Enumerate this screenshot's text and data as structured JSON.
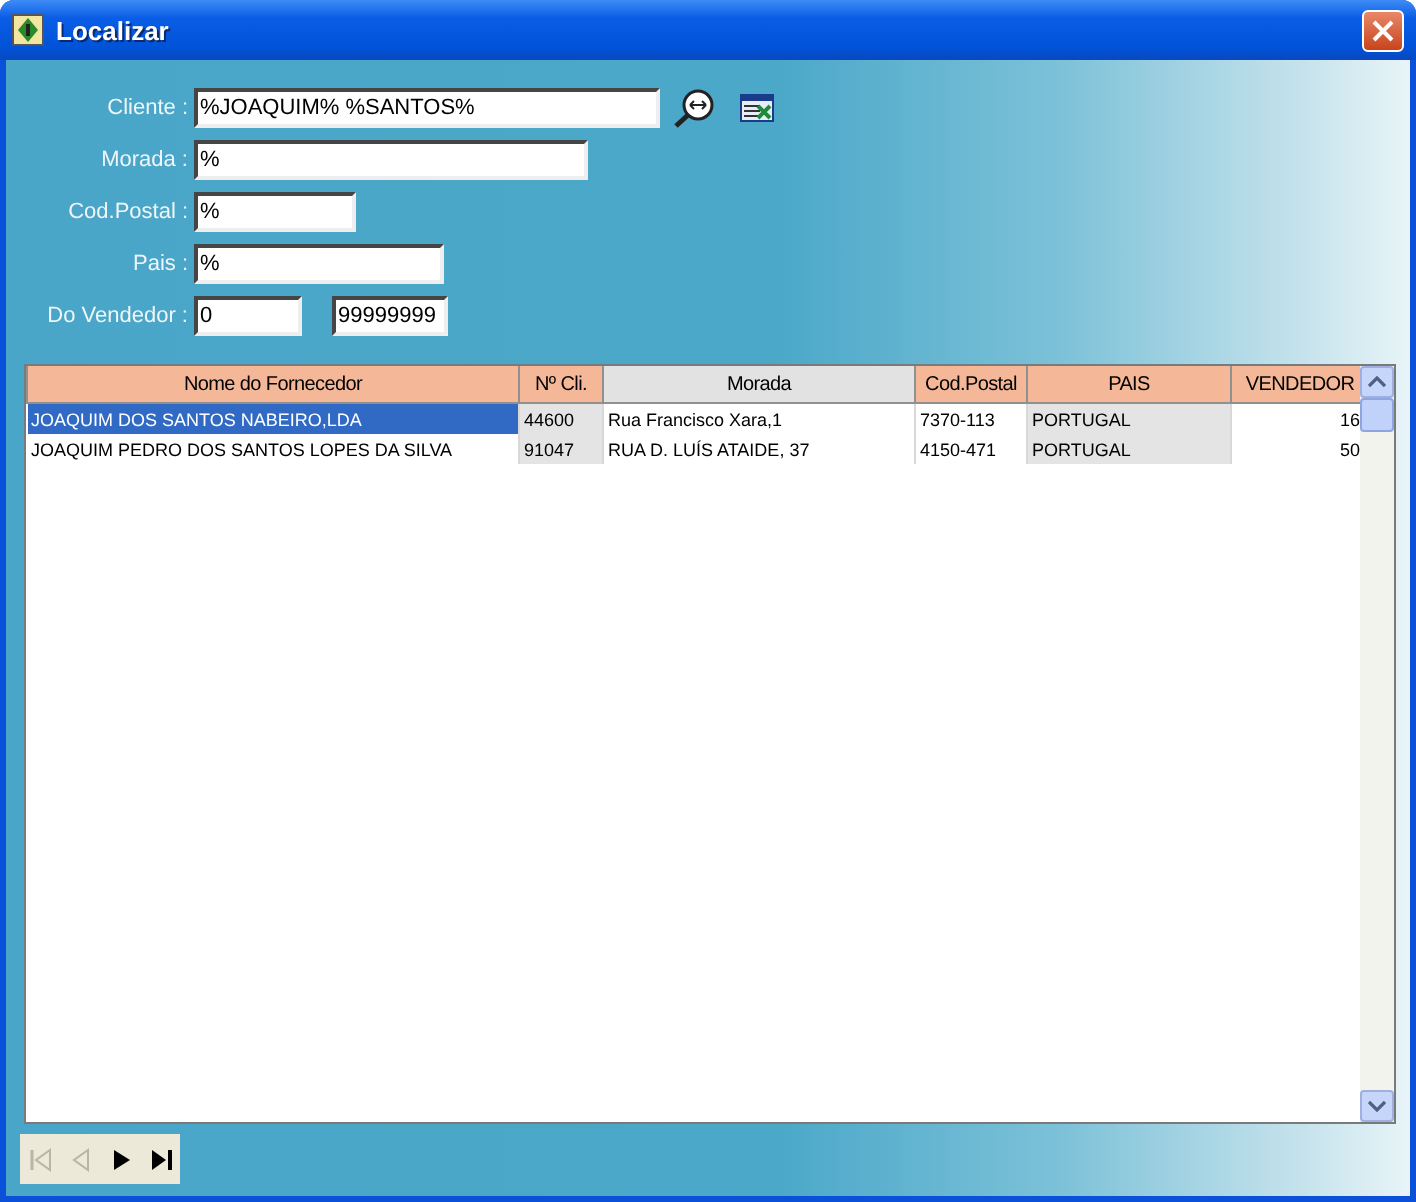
{
  "window": {
    "title": "Localizar"
  },
  "filters": [
    {
      "label": "Cliente :",
      "values": [
        "%JOAQUIM% %SANTOS%"
      ],
      "kind": "search"
    },
    {
      "label": "Morada :",
      "values": [
        "%"
      ],
      "kind": "wide"
    },
    {
      "label": "Cod.Postal :",
      "values": [
        "%"
      ],
      "kind": "short"
    },
    {
      "label": "Pais :",
      "values": [
        "%"
      ],
      "kind": "medium"
    },
    {
      "label": "Do Vendedor :",
      "values": [
        "0",
        "99999999"
      ],
      "kind": "range"
    }
  ],
  "table": {
    "columns": [
      {
        "label": "Nome do Fornecedor",
        "sorted": true,
        "shaded": false
      },
      {
        "label": "Nº Cli.",
        "sorted": true,
        "shaded": true
      },
      {
        "label": "Morada",
        "sorted": false,
        "shaded": false
      },
      {
        "label": "Cod.Postal",
        "sorted": true,
        "shaded": false
      },
      {
        "label": "PAIS",
        "sorted": true,
        "shaded": true
      },
      {
        "label": "VENDEDOR",
        "sorted": true,
        "shaded": false
      }
    ],
    "rows": [
      {
        "selected": true,
        "cells": [
          "JOAQUIM DOS SANTOS NABEIRO,LDA",
          "44600",
          "Rua Francisco Xara,1",
          "7370-113",
          "PORTUGAL",
          "16"
        ]
      },
      {
        "selected": false,
        "cells": [
          "JOAQUIM PEDRO DOS SANTOS LOPES DA SILVA",
          "91047",
          "RUA D. LUÍS ATAIDE, 37",
          "4150-471",
          "PORTUGAL",
          "50"
        ]
      }
    ]
  },
  "navigator": [
    {
      "kind": "first",
      "disabled": true
    },
    {
      "kind": "prev",
      "disabled": true
    },
    {
      "kind": "next",
      "disabled": false
    },
    {
      "kind": "last",
      "disabled": false
    }
  ]
}
